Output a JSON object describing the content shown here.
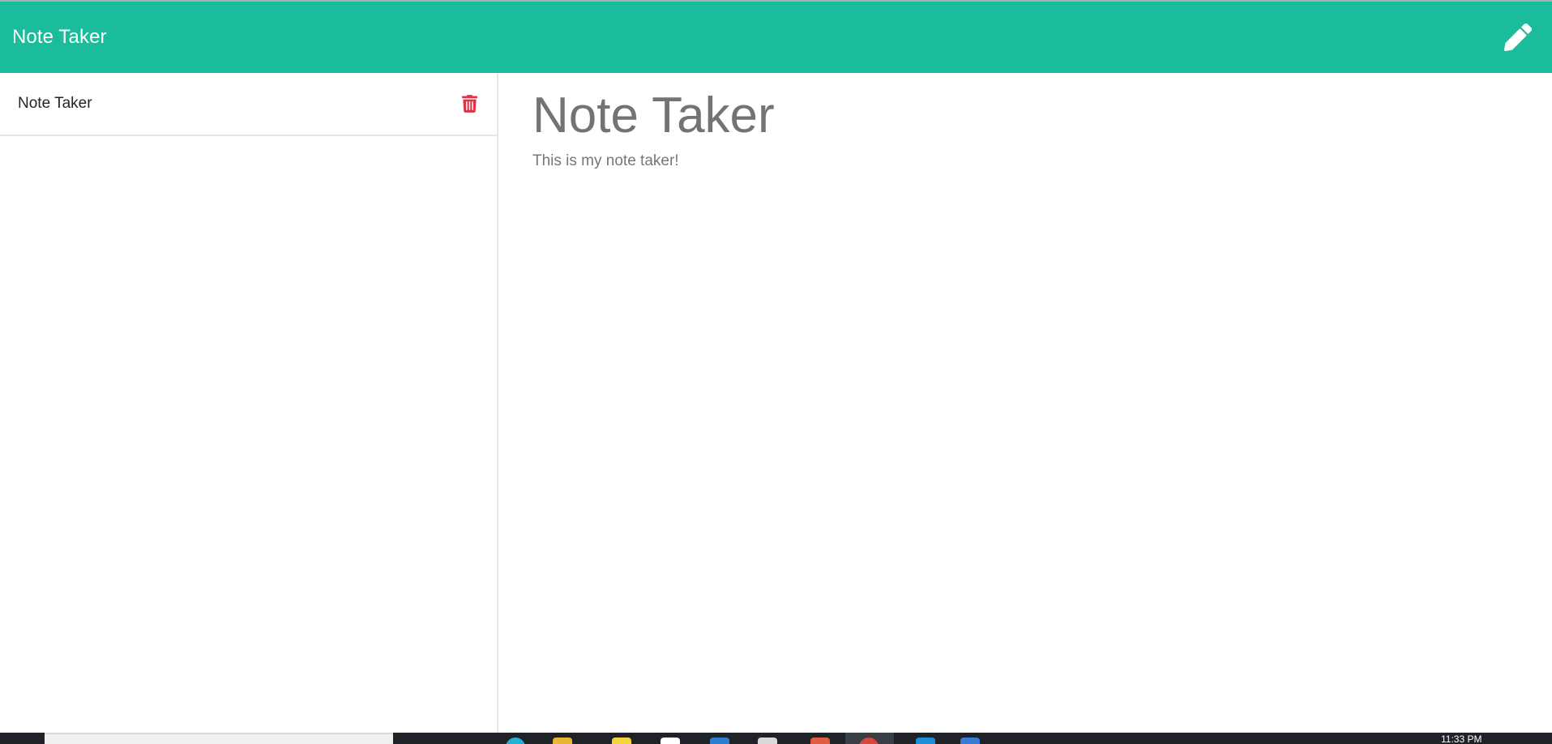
{
  "app": {
    "brand": "Note Taker",
    "new_note_icon": "pencil-icon"
  },
  "sidebar": {
    "notes": [
      {
        "title": "Note Taker",
        "delete_icon": "trash-icon"
      }
    ]
  },
  "note": {
    "title": "Note Taker",
    "text": "This is my note taker!"
  },
  "taskbar": {
    "clock": "11:33 PM"
  },
  "colors": {
    "navbar": "#1abc9c",
    "delete": "#dc3545",
    "title_text": "#737373"
  }
}
